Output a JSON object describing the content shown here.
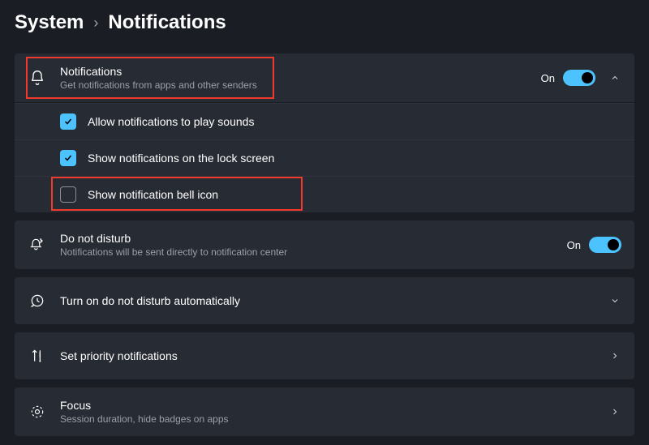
{
  "breadcrumb": {
    "parent": "System",
    "current": "Notifications"
  },
  "notifications": {
    "title": "Notifications",
    "subtitle": "Get notifications from apps and other senders",
    "state": "On",
    "options": {
      "playSounds": "Allow notifications to play sounds",
      "lockScreen": "Show notifications on the lock screen",
      "bellIcon": "Show notification bell icon"
    }
  },
  "dnd": {
    "title": "Do not disturb",
    "subtitle": "Notifications will be sent directly to notification center",
    "state": "On"
  },
  "dndAuto": {
    "title": "Turn on do not disturb automatically"
  },
  "priority": {
    "title": "Set priority notifications"
  },
  "focus": {
    "title": "Focus",
    "subtitle": "Session duration, hide badges on apps"
  }
}
